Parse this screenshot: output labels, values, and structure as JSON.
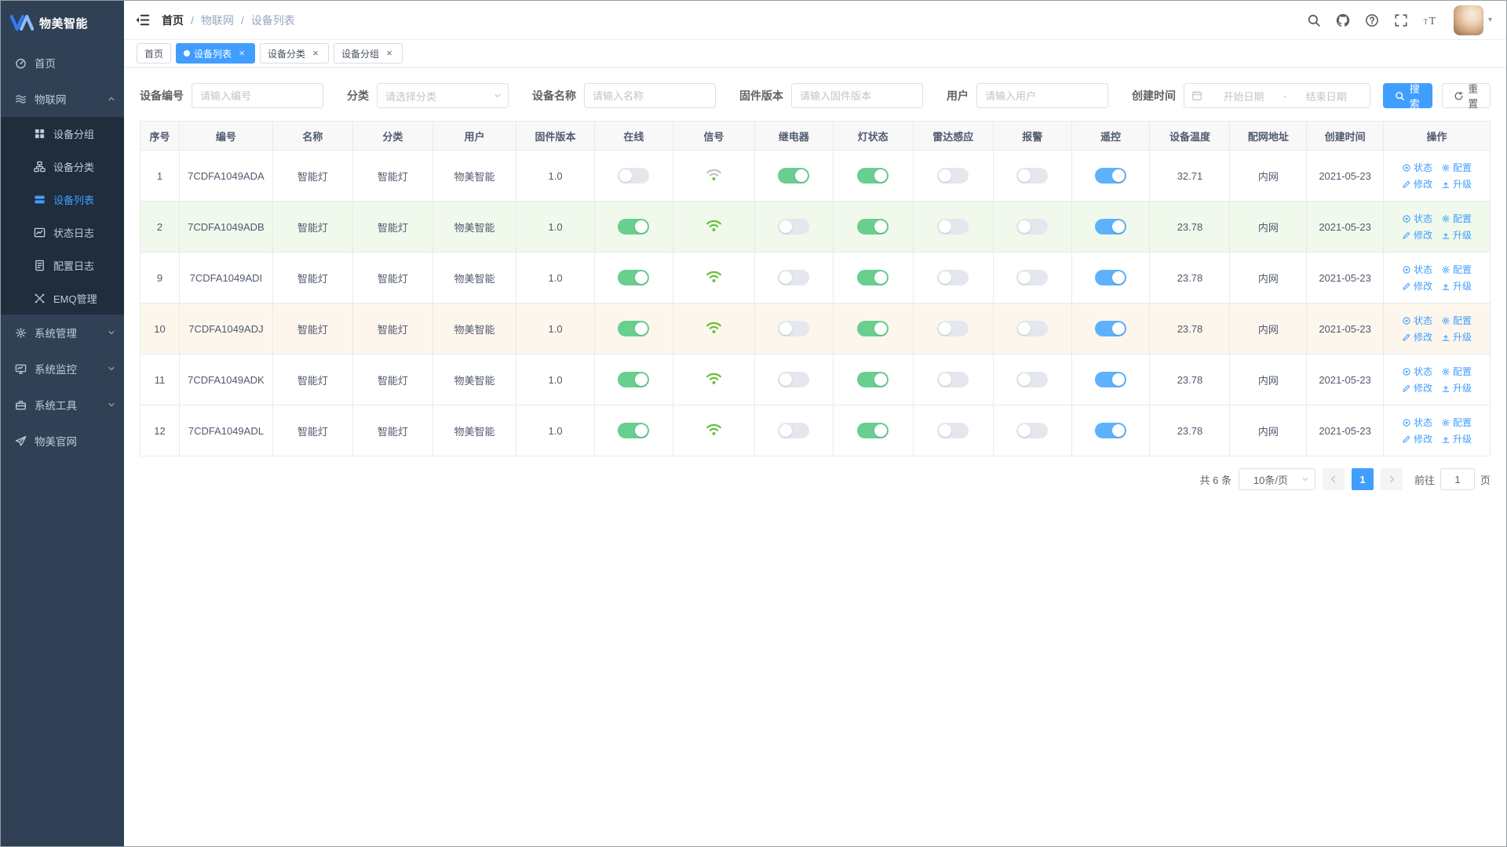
{
  "colors": {
    "accent": "#409eff",
    "toggle_green": "#68cf8e",
    "toggle_blue": "#5eb2fc",
    "wifi_green": "#67c23a",
    "wifi_gray": "#c0c4cc",
    "stripe_green": "#f0f9eb",
    "stripe_warm": "#fdf6ec",
    "sidebar_bg": "#304156",
    "submenu_bg": "#1f2d3d"
  },
  "sidebar": {
    "logo_text": "物美智能",
    "items": [
      {
        "id": "home",
        "icon": "dashboard-icon",
        "label": "首页"
      },
      {
        "id": "iot",
        "icon": "iot-icon",
        "label": "物联网",
        "expanded": true,
        "children": [
          {
            "id": "device-group",
            "icon": "grid-icon",
            "label": "设备分组"
          },
          {
            "id": "device-category",
            "icon": "sitemap-icon",
            "label": "设备分类"
          },
          {
            "id": "device-list",
            "icon": "list-icon",
            "label": "设备列表",
            "active": true
          },
          {
            "id": "status-log",
            "icon": "status-log-icon",
            "label": "状态日志"
          },
          {
            "id": "config-log",
            "icon": "config-log-icon",
            "label": "配置日志"
          },
          {
            "id": "emq-manage",
            "icon": "emq-icon",
            "label": "EMQ管理"
          }
        ]
      },
      {
        "id": "system-admin",
        "icon": "gear-icon",
        "label": "系统管理",
        "collapsible": true
      },
      {
        "id": "system-monitor",
        "icon": "monitor-icon",
        "label": "系统监控",
        "collapsible": true
      },
      {
        "id": "system-tools",
        "icon": "toolbox-icon",
        "label": "系统工具",
        "collapsible": true
      },
      {
        "id": "official-site",
        "icon": "paper-plane-icon",
        "label": "物美官网"
      }
    ]
  },
  "topbar": {
    "breadcrumb": [
      "首页",
      "物联网",
      "设备列表"
    ],
    "actions": [
      {
        "id": "search",
        "icon": "search-icon"
      },
      {
        "id": "github",
        "icon": "github-icon"
      },
      {
        "id": "help",
        "icon": "question-icon"
      },
      {
        "id": "fullscreen",
        "icon": "fullscreen-icon"
      },
      {
        "id": "font-size",
        "icon": "font-size-icon"
      }
    ]
  },
  "tags": [
    {
      "id": "home",
      "label": "首页",
      "active": false,
      "closable": false
    },
    {
      "id": "device-list",
      "label": "设备列表",
      "active": true,
      "closable": true
    },
    {
      "id": "device-category",
      "label": "设备分类",
      "active": false,
      "closable": true
    },
    {
      "id": "device-group",
      "label": "设备分组",
      "active": false,
      "closable": true
    }
  ],
  "filters": {
    "device_no": {
      "label": "设备编号",
      "placeholder": "请输入编号"
    },
    "category": {
      "label": "分类",
      "placeholder": "请选择分类"
    },
    "device_name": {
      "label": "设备名称",
      "placeholder": "请输入名称"
    },
    "firmware": {
      "label": "固件版本",
      "placeholder": "请输入固件版本"
    },
    "user": {
      "label": "用户",
      "placeholder": "请输入用户"
    },
    "created": {
      "label": "创建时间",
      "start_placeholder": "开始日期",
      "separator": "-",
      "end_placeholder": "结束日期"
    },
    "search_label": "搜索",
    "reset_label": "重置"
  },
  "table": {
    "columns": [
      "序号",
      "编号",
      "名称",
      "分类",
      "用户",
      "固件版本",
      "在线",
      "信号",
      "继电器",
      "灯状态",
      "雷达感应",
      "报警",
      "遥控",
      "设备温度",
      "配网地址",
      "创建时间",
      "操作"
    ],
    "ops": [
      "状态",
      "配置",
      "修改",
      "升级"
    ],
    "rows": [
      {
        "seq": "1",
        "code": "7CDFA1049ADA",
        "name": "智能灯",
        "category": "智能灯",
        "user": "物美智能",
        "firmware": "1.0",
        "online": false,
        "signal": "weak",
        "relay": true,
        "light": true,
        "radar": false,
        "alarm": false,
        "remote": true,
        "temp": "32.71",
        "network": "内网",
        "created": "2021-05-23",
        "stripe": "none"
      },
      {
        "seq": "2",
        "code": "7CDFA1049ADB",
        "name": "智能灯",
        "category": "智能灯",
        "user": "物美智能",
        "firmware": "1.0",
        "online": true,
        "signal": "strong",
        "relay": false,
        "light": true,
        "radar": false,
        "alarm": false,
        "remote": true,
        "temp": "23.78",
        "network": "内网",
        "created": "2021-05-23",
        "stripe": "green"
      },
      {
        "seq": "9",
        "code": "7CDFA1049ADI",
        "name": "智能灯",
        "category": "智能灯",
        "user": "物美智能",
        "firmware": "1.0",
        "online": true,
        "signal": "strong",
        "relay": false,
        "light": true,
        "radar": false,
        "alarm": false,
        "remote": true,
        "temp": "23.78",
        "network": "内网",
        "created": "2021-05-23",
        "stripe": "none"
      },
      {
        "seq": "10",
        "code": "7CDFA1049ADJ",
        "name": "智能灯",
        "category": "智能灯",
        "user": "物美智能",
        "firmware": "1.0",
        "online": true,
        "signal": "strong",
        "relay": false,
        "light": true,
        "radar": false,
        "alarm": false,
        "remote": true,
        "temp": "23.78",
        "network": "内网",
        "created": "2021-05-23",
        "stripe": "warm"
      },
      {
        "seq": "11",
        "code": "7CDFA1049ADK",
        "name": "智能灯",
        "category": "智能灯",
        "user": "物美智能",
        "firmware": "1.0",
        "online": true,
        "signal": "strong",
        "relay": false,
        "light": true,
        "radar": false,
        "alarm": false,
        "remote": true,
        "temp": "23.78",
        "network": "内网",
        "created": "2021-05-23",
        "stripe": "none"
      },
      {
        "seq": "12",
        "code": "7CDFA1049ADL",
        "name": "智能灯",
        "category": "智能灯",
        "user": "物美智能",
        "firmware": "1.0",
        "online": true,
        "signal": "strong",
        "relay": false,
        "light": true,
        "radar": false,
        "alarm": false,
        "remote": true,
        "temp": "23.78",
        "network": "内网",
        "created": "2021-05-23",
        "stripe": "none"
      }
    ]
  },
  "pagination": {
    "total": "共 6 条",
    "page_size": "10条/页",
    "page": "1",
    "goto_label": "前往",
    "page_unit": "页"
  }
}
